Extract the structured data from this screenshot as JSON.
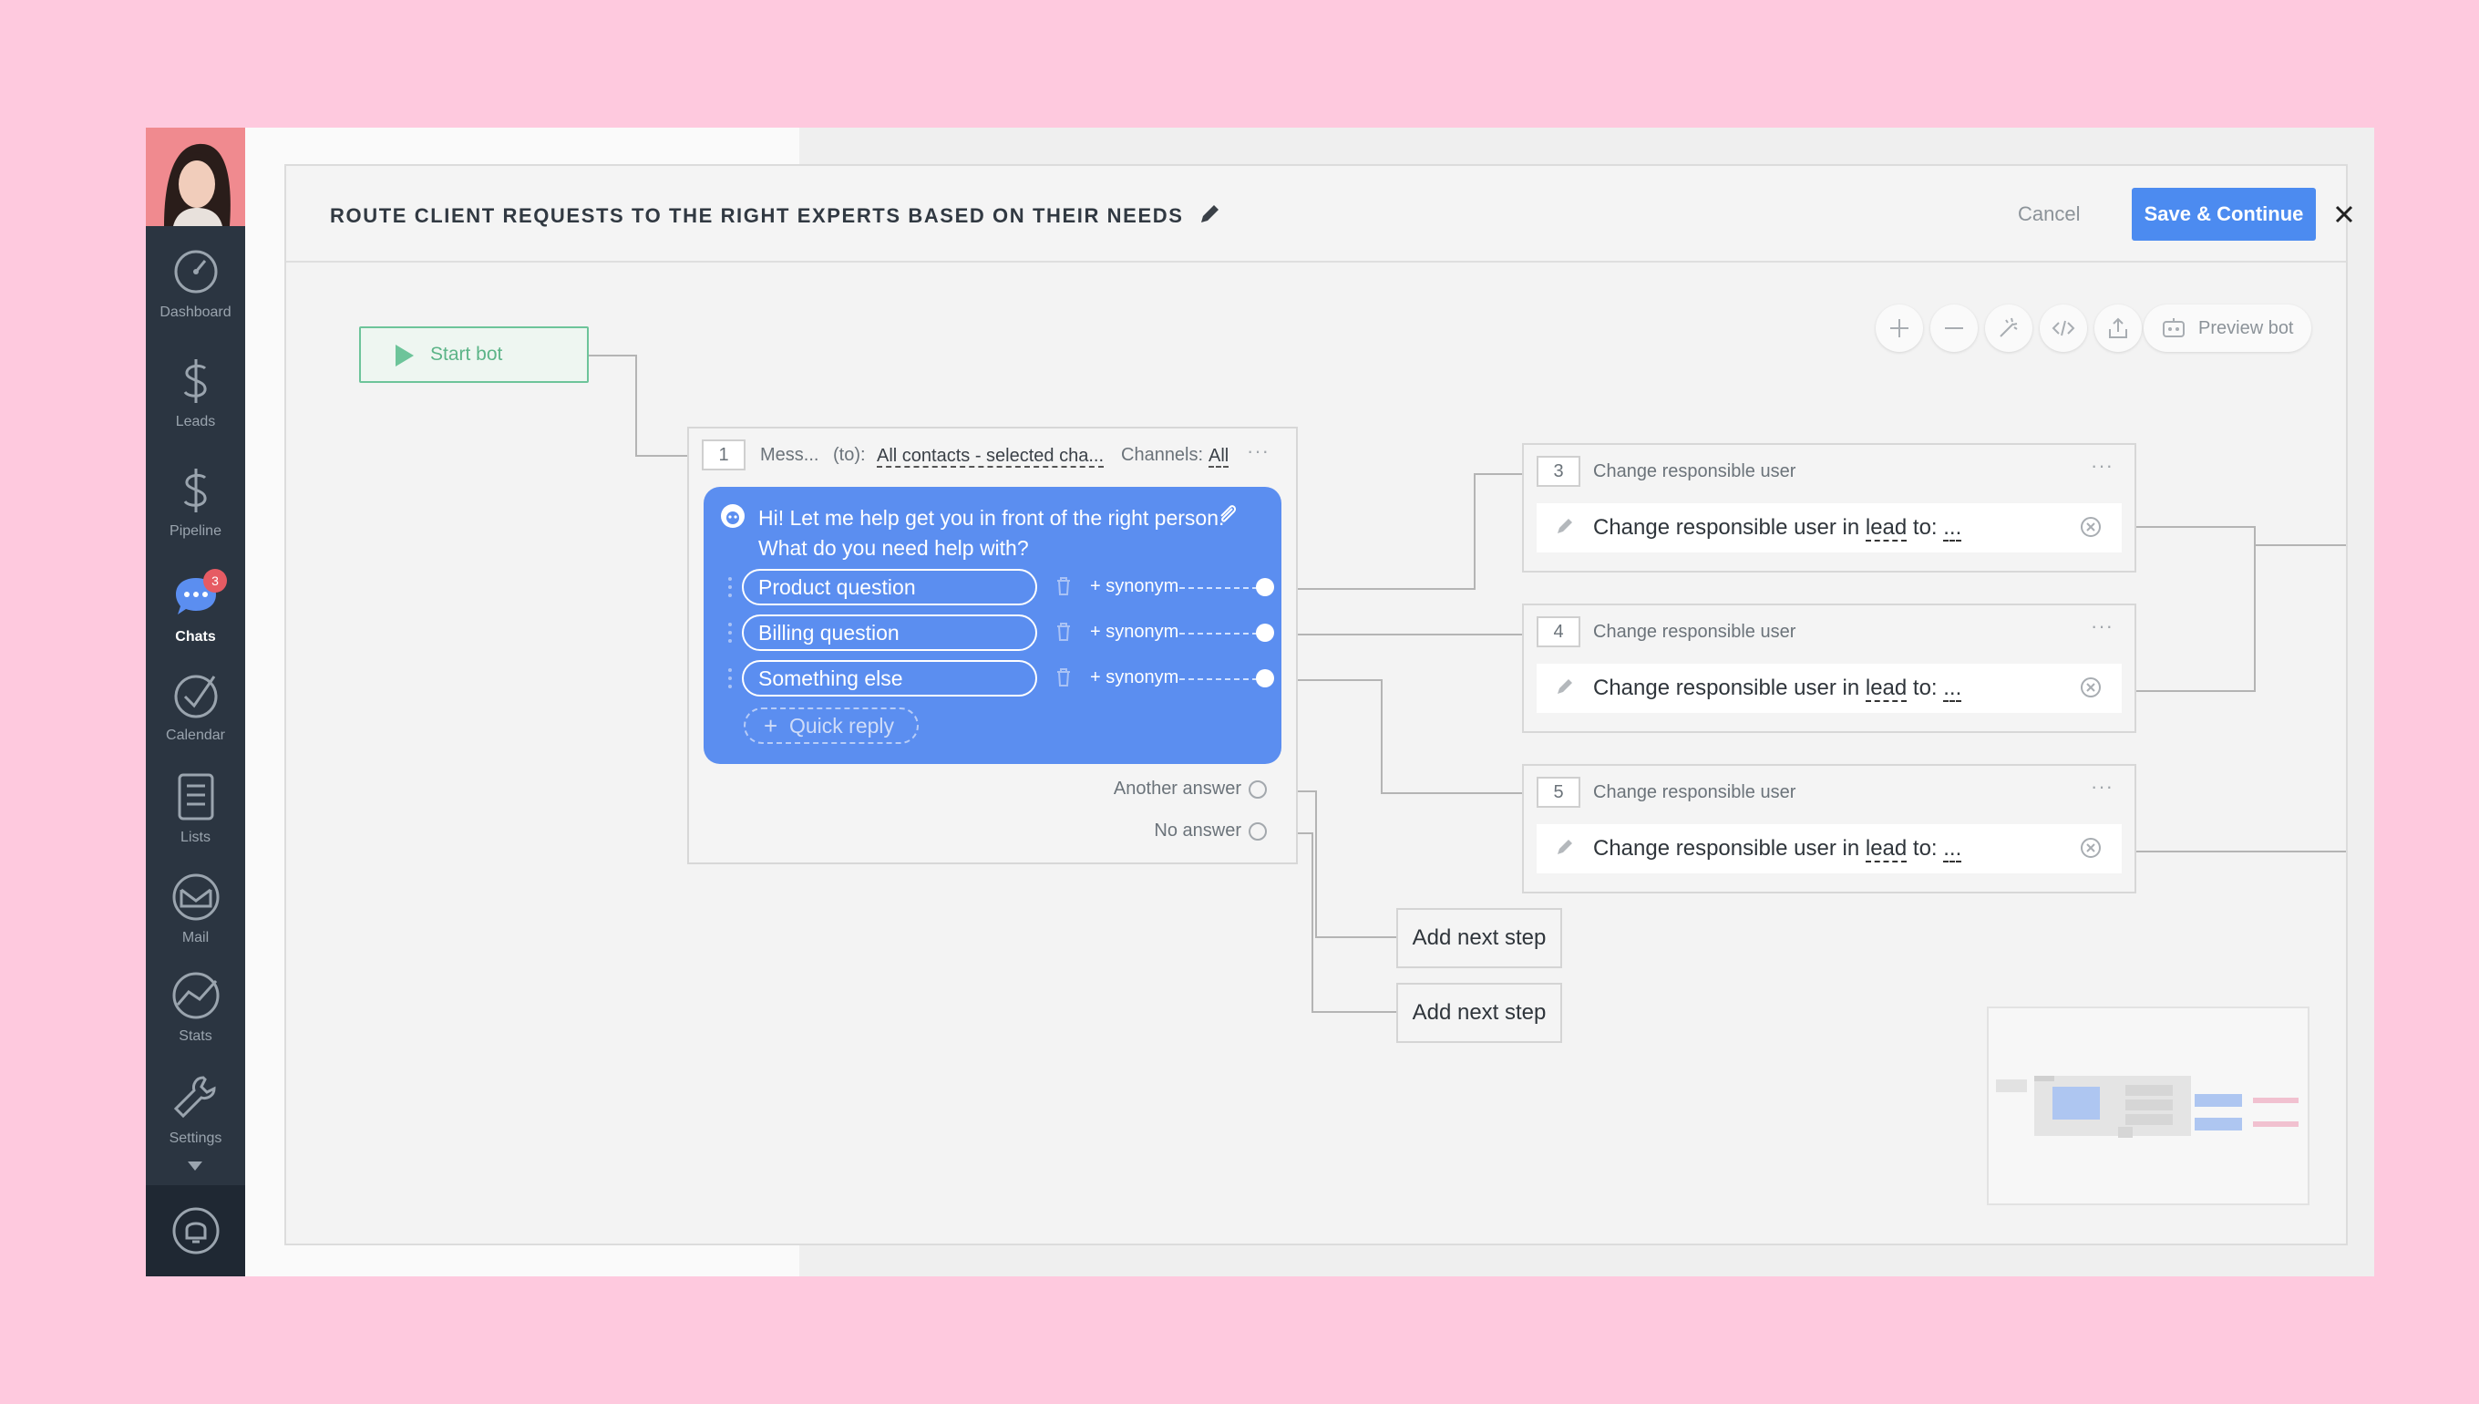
{
  "sidebar": {
    "items": [
      {
        "label": "Dashboard",
        "icon": "dashboard-icon"
      },
      {
        "label": "Leads",
        "icon": "dollar-icon"
      },
      {
        "label": "Pipeline",
        "icon": "dollar-icon"
      },
      {
        "label": "Chats",
        "icon": "chat-icon",
        "badge": "3"
      },
      {
        "label": "Calendar",
        "icon": "check-circle-icon"
      },
      {
        "label": "Lists",
        "icon": "list-icon"
      },
      {
        "label": "Mail",
        "icon": "mail-icon"
      },
      {
        "label": "Stats",
        "icon": "stats-icon"
      },
      {
        "label": "Settings",
        "icon": "wrench-icon"
      }
    ]
  },
  "modal": {
    "title": "ROUTE CLIENT REQUESTS TO THE RIGHT EXPERTS BASED ON THEIR NEEDS",
    "cancel_label": "Cancel",
    "save_label": "Save & Continue"
  },
  "toolbar": {
    "preview_label": "Preview bot"
  },
  "start_bot": {
    "label": "Start bot"
  },
  "step1": {
    "number": "1",
    "type": "Mess...",
    "to_label": "(to):",
    "to_value": "All contacts - selected cha...",
    "channels_label": "Channels:",
    "channels_value": "All",
    "message": "Hi! Let me help get you in front of the right person. What do you need help with?",
    "replies": [
      {
        "label": "Product question",
        "synonym": "+ synonym"
      },
      {
        "label": "Billing question",
        "synonym": "+ synonym"
      },
      {
        "label": "Something else",
        "synonym": "+ synonym"
      }
    ],
    "quick_reply_label": "Quick reply",
    "another_answer": "Another answer",
    "no_answer": "No answer"
  },
  "steps": [
    {
      "number": "3",
      "title": "Change responsible user",
      "action_prefix": "Change responsible user in",
      "action_entity": "lead",
      "action_to": "to:",
      "action_value": "..."
    },
    {
      "number": "4",
      "title": "Change responsible user",
      "action_prefix": "Change responsible user in",
      "action_entity": "lead",
      "action_to": "to:",
      "action_value": "..."
    },
    {
      "number": "5",
      "title": "Change responsible user",
      "action_prefix": "Change responsible user in",
      "action_entity": "lead",
      "action_to": "to:",
      "action_value": "..."
    }
  ],
  "add_next_step": [
    "Add next step",
    "Add next step"
  ],
  "colors": {
    "accent": "#4c8bf0",
    "bubble": "#5b8ef0",
    "start_green": "#6dc49a",
    "sidebar": "#2b3541",
    "background": "#fec9de"
  }
}
